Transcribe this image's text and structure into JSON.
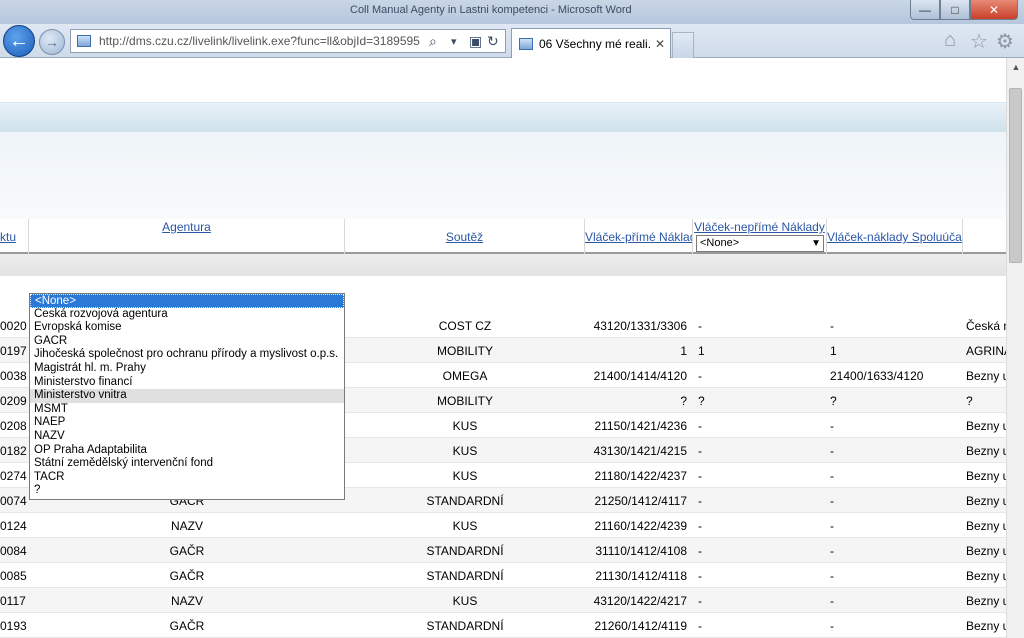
{
  "window": {
    "title": "Coll Manual Agenty in Lastni kompetenci - Microsoft Word",
    "min": "—",
    "max": "□",
    "close": "✕"
  },
  "browser": {
    "back": "←",
    "forward": "→",
    "url": "http://dms.czu.cz/livelink/livelink.exe?func=ll&objId=3189595",
    "tab_title": "06 Všechny mé reali...",
    "tab_close": "✕",
    "search_glyph": "⌕",
    "dropdown_glyph": "▾",
    "refresh_glyph": "↻",
    "home_glyph": "⌂",
    "star_glyph": "☆",
    "gear_glyph": "⚙"
  },
  "table": {
    "columns": {
      "projektu": "ktu",
      "agentura": "Agentura",
      "soutez": "Soutěž",
      "prime": "Vláček-přímé Náklady",
      "neprime": "Vláček-nepřímé Náklady",
      "spoluucast": "Vláček-náklady Spoluúčast"
    },
    "neprime_filter": "<None>",
    "rows": [
      {
        "id": "0020",
        "agentura": "",
        "soutez": "COST CZ",
        "prime": "43120/1331/3306",
        "neprime": "-",
        "spolu": "-",
        "last": "Česká na"
      },
      {
        "id": "0197",
        "agentura": "",
        "soutez": "MOBILITY",
        "prime": "1",
        "neprime": "1",
        "spolu": "1",
        "last": "AGRINAT"
      },
      {
        "id": "0038",
        "agentura": "",
        "soutez": "OMEGA",
        "prime": "21400/1414/4120",
        "neprime": "-",
        "spolu": "21400/1633/4120",
        "last": "Bezny u"
      },
      {
        "id": "0209",
        "agentura": "",
        "soutez": "MOBILITY",
        "prime": "?",
        "neprime": "?",
        "spolu": "?",
        "last": "?"
      },
      {
        "id": "0208",
        "agentura": "",
        "soutez": "KUS",
        "prime": "21150/1421/4236",
        "neprime": "-",
        "spolu": "-",
        "last": "Bezny u"
      },
      {
        "id": "0182",
        "agentura": "",
        "soutez": "KUS",
        "prime": "43130/1421/4215",
        "neprime": "-",
        "spolu": "-",
        "last": "Bezny u"
      },
      {
        "id": "0274",
        "agentura": "",
        "soutez": "KUS",
        "prime": "21180/1422/4237",
        "neprime": "-",
        "spolu": "-",
        "last": "Bezny u"
      },
      {
        "id": "0074",
        "agentura": "GAČR",
        "soutez": "STANDARDNÍ",
        "prime": "21250/1412/4117",
        "neprime": "-",
        "spolu": "-",
        "last": "Bezny u"
      },
      {
        "id": "0124",
        "agentura": "NAZV",
        "soutez": "KUS",
        "prime": "21160/1422/4239",
        "neprime": "-",
        "spolu": "-",
        "last": "Bezny u"
      },
      {
        "id": "0084",
        "agentura": "GAČR",
        "soutez": "STANDARDNÍ",
        "prime": "31110/1412/4108",
        "neprime": "-",
        "spolu": "-",
        "last": "Bezny u"
      },
      {
        "id": "0085",
        "agentura": "GAČR",
        "soutez": "STANDARDNÍ",
        "prime": "21130/1412/4118",
        "neprime": "-",
        "spolu": "-",
        "last": "Bezny u"
      },
      {
        "id": "0117",
        "agentura": "NAZV",
        "soutez": "KUS",
        "prime": "43120/1422/4217",
        "neprime": "-",
        "spolu": "-",
        "last": "Bezny u"
      },
      {
        "id": "0193",
        "agentura": "GAČR",
        "soutez": "STANDARDNÍ",
        "prime": "21260/1412/4119",
        "neprime": "-",
        "spolu": "-",
        "last": "Bezny u"
      }
    ]
  },
  "agentura_dropdown": {
    "options": [
      "<None>",
      "Česká rozvojová agentura",
      "Evropská komise",
      "GAČR",
      "Jihočeská společnost pro ochranu přírody a myslivost o.p.s.",
      "Magistrát hl. m. Prahy",
      "Ministerstvo financí",
      "Ministerstvo vnitra",
      "MŠMT",
      "NAEP",
      "NAZV",
      "OP Praha Adaptabilita",
      "Státní zemědělský intervenční fond",
      "TAČR",
      "?"
    ],
    "selected_index": 0,
    "hover_index": 7
  }
}
